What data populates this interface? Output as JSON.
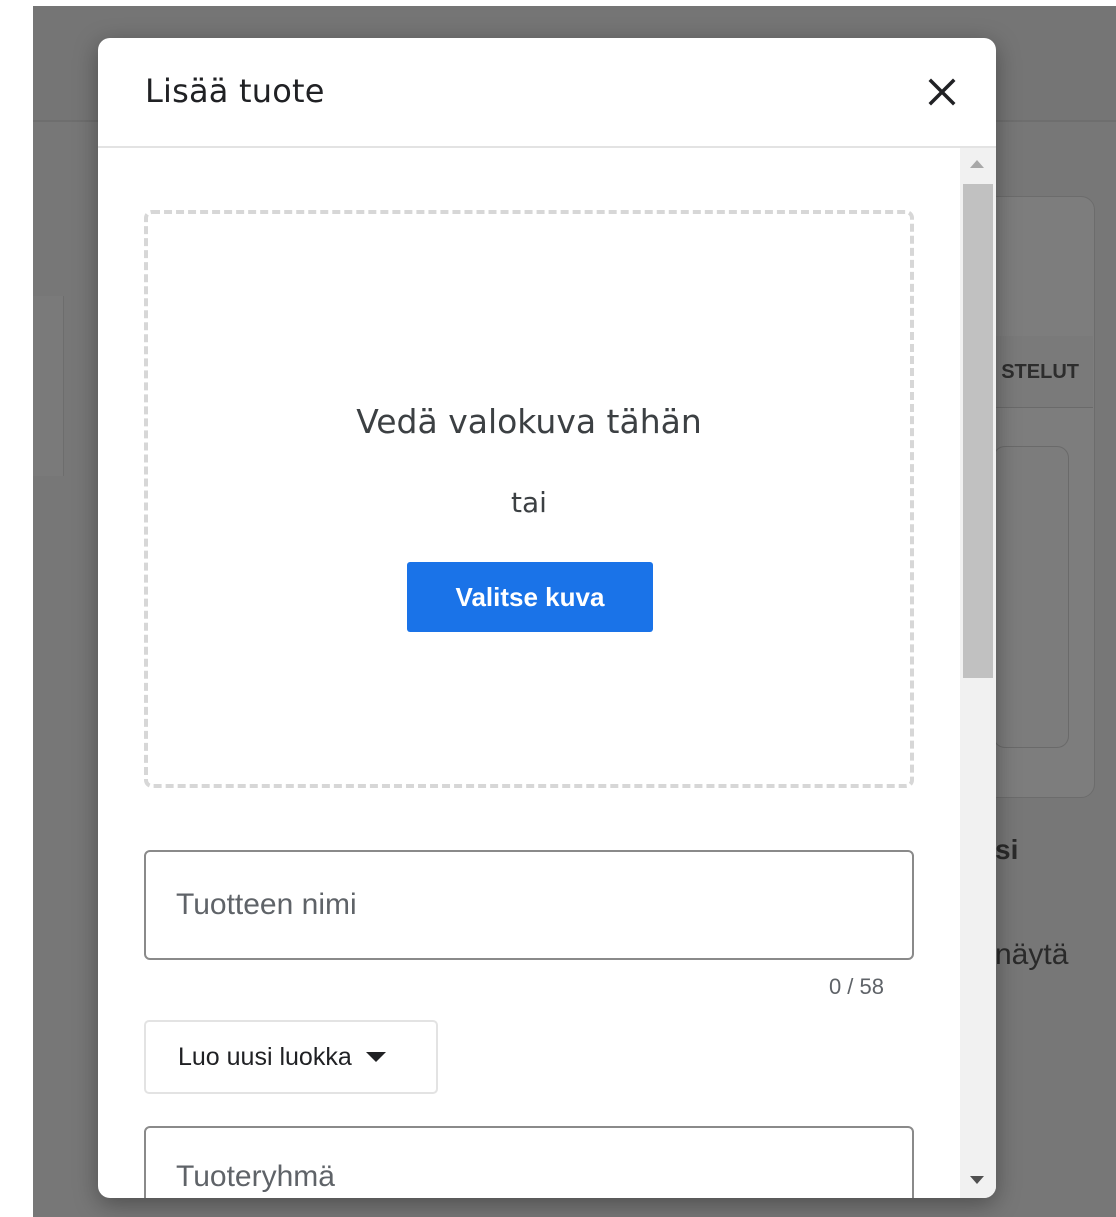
{
  "background": {
    "tab_label": "STELUT",
    "heading_fragment": "si",
    "text_fragment": "näytä"
  },
  "dialog": {
    "title": "Lisää tuote",
    "close_icon": "close-icon",
    "dropzone": {
      "drag_text": "Vedä valokuva tähän",
      "or_text": "tai",
      "choose_button": "Valitse kuva"
    },
    "product_name": {
      "placeholder": "Tuotteen nimi",
      "value": "",
      "counter": "0 / 58"
    },
    "category_button": "Luo uusi luokka",
    "product_group": {
      "placeholder": "Tuoteryhmä"
    }
  },
  "colors": {
    "accent": "#1a73e8",
    "overlay": "#777777"
  }
}
